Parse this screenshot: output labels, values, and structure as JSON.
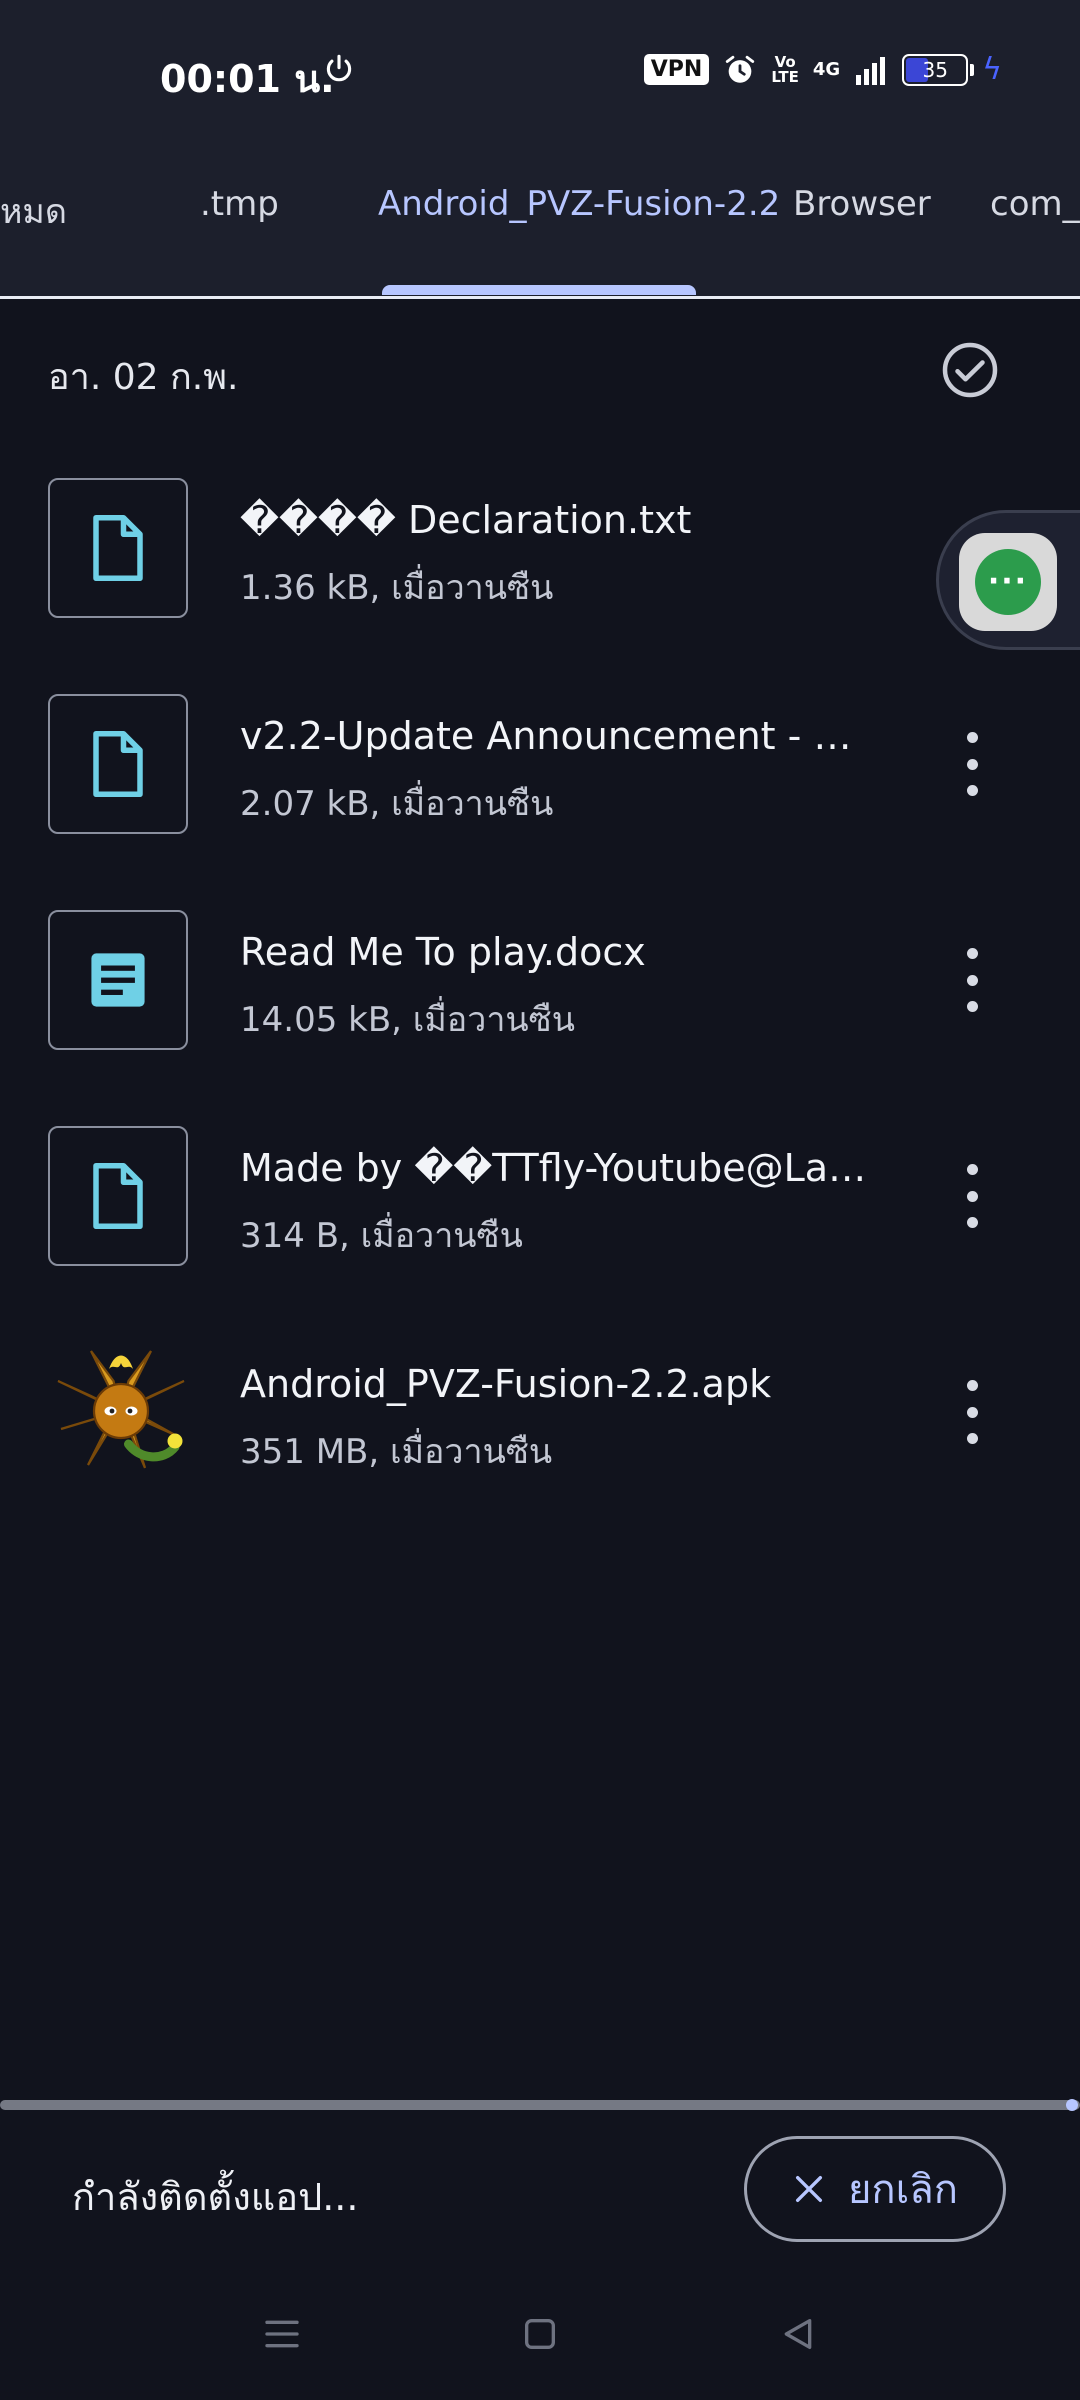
{
  "status_bar": {
    "time": "00:01 น.",
    "vpn": "VPN",
    "volte": [
      "Vo",
      "LTE"
    ],
    "network": "4G",
    "battery": "35",
    "battery_level": 0.35
  },
  "tabs": [
    {
      "label": "หมด",
      "active": false
    },
    {
      "label": ".tmp",
      "active": false
    },
    {
      "label": "Android_PVZ-Fusion-2.2",
      "active": true
    },
    {
      "label": "Browser",
      "active": false
    },
    {
      "label": "com_ad",
      "active": false
    }
  ],
  "date_header": "อา. 02 ก.พ.",
  "files": [
    {
      "name": "���� Declaration.txt",
      "meta": "1.36 kB, เมื่อวานซืน",
      "icon": "file-icon"
    },
    {
      "name": "v2.2-Update Announcement - ���···",
      "meta": "2.07 kB, เมื่อวานซืน",
      "icon": "file-icon"
    },
    {
      "name": "Read Me To play.docx",
      "meta": "14.05 kB, เมื่อวานซืน",
      "icon": "document-icon"
    },
    {
      "name": "Made by ��ТТfly-Youtube@Lanpia···",
      "meta": "314 B, เมื่อวานซืน",
      "icon": "file-icon"
    },
    {
      "name": "Android_PVZ-Fusion-2.2.apk",
      "meta": "351 MB, เมื่อวานซืน",
      "icon": "apk-app-icon"
    }
  ],
  "bottom": {
    "install_status": "กำลังติดตั้งแอป...",
    "cancel_label": "ยกเลิก",
    "progress": 1.0
  },
  "colors": {
    "background": "#11131d",
    "accent": "#b7c6ff",
    "file_icon": "#6fd0e6"
  }
}
